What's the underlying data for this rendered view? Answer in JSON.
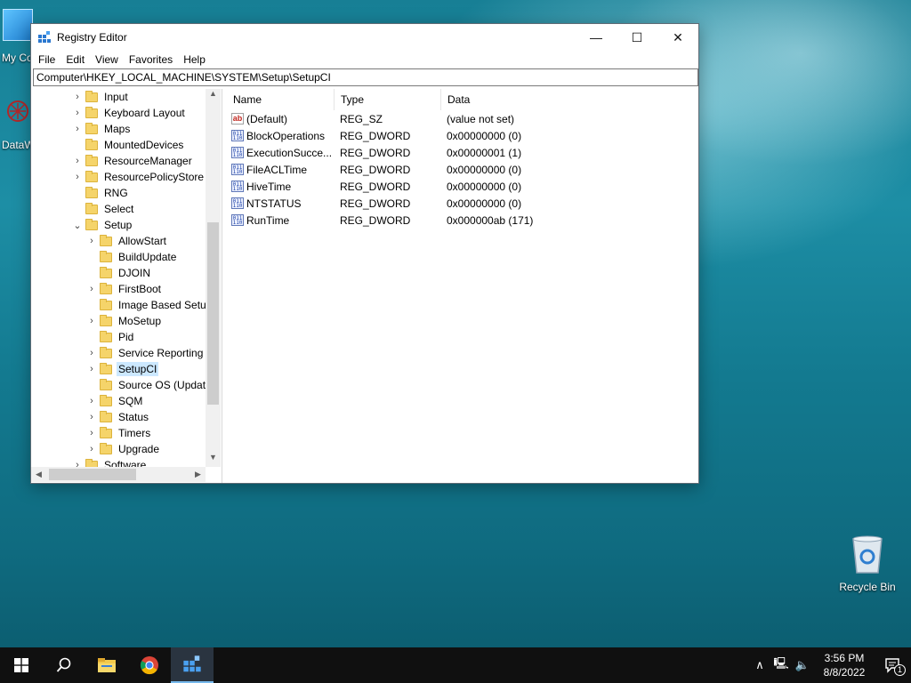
{
  "desktop": {
    "icons": [
      {
        "label": "My Co"
      },
      {
        "label": "DataW"
      },
      {
        "label": "Recycle Bin"
      }
    ]
  },
  "window": {
    "title": "Registry Editor",
    "controls": {
      "minimize": "—",
      "maximize": "☐",
      "close": "✕"
    },
    "menu": [
      "File",
      "Edit",
      "View",
      "Favorites",
      "Help"
    ],
    "address": "Computer\\HKEY_LOCAL_MACHINE\\SYSTEM\\Setup\\SetupCI",
    "tree": [
      {
        "label": "Input",
        "chev": "›",
        "level": 1
      },
      {
        "label": "Keyboard Layout",
        "chev": "›",
        "level": 1
      },
      {
        "label": "Maps",
        "chev": "›",
        "level": 1
      },
      {
        "label": "MountedDevices",
        "chev": "",
        "level": 1
      },
      {
        "label": "ResourceManager",
        "chev": "›",
        "level": 1
      },
      {
        "label": "ResourcePolicyStore",
        "chev": "›",
        "level": 1
      },
      {
        "label": "RNG",
        "chev": "",
        "level": 1
      },
      {
        "label": "Select",
        "chev": "",
        "level": 1
      },
      {
        "label": "Setup",
        "chev": "⌄",
        "level": 1
      },
      {
        "label": "AllowStart",
        "chev": "›",
        "level": 2
      },
      {
        "label": "BuildUpdate",
        "chev": "",
        "level": 2
      },
      {
        "label": "DJOIN",
        "chev": "",
        "level": 2
      },
      {
        "label": "FirstBoot",
        "chev": "›",
        "level": 2
      },
      {
        "label": "Image Based Setup",
        "chev": "",
        "level": 2
      },
      {
        "label": "MoSetup",
        "chev": "›",
        "level": 2
      },
      {
        "label": "Pid",
        "chev": "",
        "level": 2
      },
      {
        "label": "Service Reporting A",
        "chev": "›",
        "level": 2
      },
      {
        "label": "SetupCI",
        "chev": "›",
        "level": 2,
        "selected": true
      },
      {
        "label": "Source OS (Update",
        "chev": "",
        "level": 2
      },
      {
        "label": "SQM",
        "chev": "›",
        "level": 2
      },
      {
        "label": "Status",
        "chev": "›",
        "level": 2
      },
      {
        "label": "Timers",
        "chev": "›",
        "level": 2
      },
      {
        "label": "Upgrade",
        "chev": "›",
        "level": 2
      },
      {
        "label": "Software",
        "chev": "›",
        "level": 1
      }
    ],
    "columns": {
      "name": "Name",
      "type": "Type",
      "data": "Data"
    },
    "values": [
      {
        "name": "(Default)",
        "type": "REG_SZ",
        "data": "(value not set)",
        "icon": "string"
      },
      {
        "name": "BlockOperations",
        "type": "REG_DWORD",
        "data": "0x00000000 (0)",
        "icon": "binary"
      },
      {
        "name": "ExecutionSucce...",
        "type": "REG_DWORD",
        "data": "0x00000001 (1)",
        "icon": "binary"
      },
      {
        "name": "FileACLTime",
        "type": "REG_DWORD",
        "data": "0x00000000 (0)",
        "icon": "binary"
      },
      {
        "name": "HiveTime",
        "type": "REG_DWORD",
        "data": "0x00000000 (0)",
        "icon": "binary"
      },
      {
        "name": "NTSTATUS",
        "type": "REG_DWORD",
        "data": "0x00000000 (0)",
        "icon": "binary"
      },
      {
        "name": "RunTime",
        "type": "REG_DWORD",
        "data": "0x000000ab (171)",
        "icon": "binary"
      }
    ]
  },
  "taskbar": {
    "apps": [
      "start",
      "search",
      "file-explorer",
      "chrome",
      "registry-editor"
    ],
    "clock": {
      "time": "3:56 PM",
      "date": "8/8/2022"
    },
    "notification_count": "1"
  }
}
